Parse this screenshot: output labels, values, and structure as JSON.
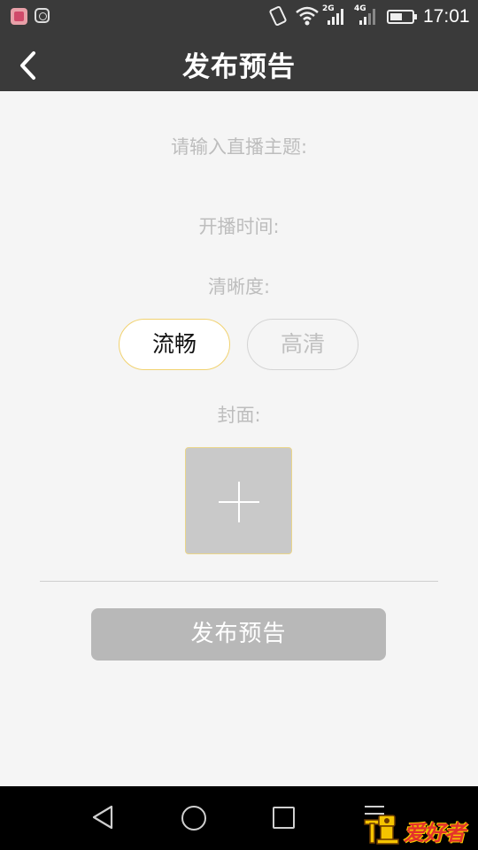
{
  "status_bar": {
    "network_2g": "2G",
    "network_4g": "4G",
    "time": "17:01",
    "icons": [
      "app-icon-1",
      "app-icon-2",
      "vibrate-icon",
      "wifi-icon",
      "signal-icon",
      "signal-icon",
      "battery-icon"
    ]
  },
  "header": {
    "title": "发布预告",
    "back_icon": "chevron-left-icon"
  },
  "form": {
    "topic_label": "请输入直播主题:",
    "time_label": "开播时间:",
    "quality_label": "清晰度:",
    "quality_options": [
      {
        "label": "流畅",
        "selected": true
      },
      {
        "label": "高清",
        "selected": false
      }
    ],
    "cover_label": "封面:",
    "cover_add_icon": "plus-icon",
    "submit_label": "发布预告"
  },
  "nav_bar": {
    "icons": [
      "back-triangle-icon",
      "home-circle-icon",
      "recent-square-icon",
      "menu-icon"
    ]
  },
  "watermark": {
    "logo_text": "爱好者"
  },
  "colors": {
    "title_bar": "#3a3a3a",
    "background": "#f5f5f5",
    "selected_border": "#f1d270",
    "submit_bg": "#b8b8b8",
    "label_text": "#bdbdbd"
  }
}
